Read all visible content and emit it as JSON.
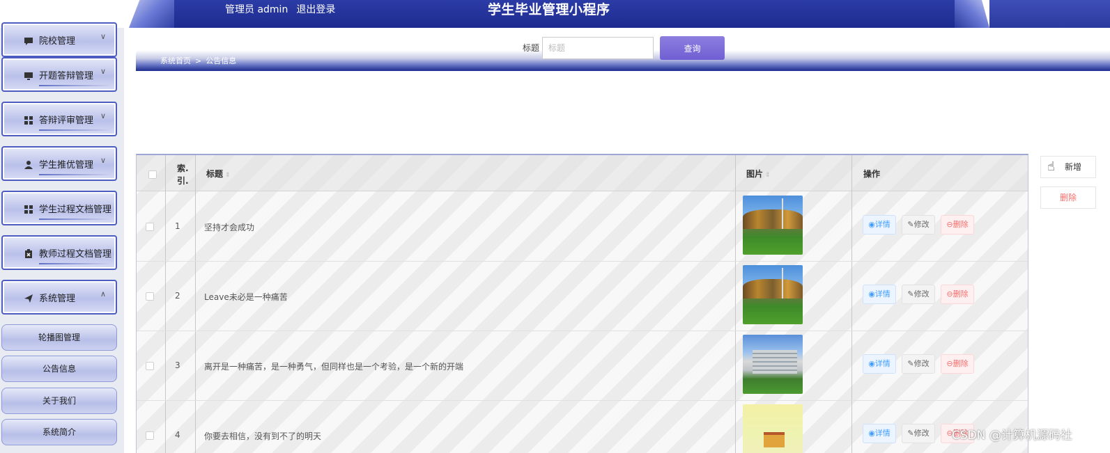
{
  "header": {
    "user_label": "管理员 admin",
    "logout_label": "退出登录",
    "app_title": "学生毕业管理小程序"
  },
  "sidebar": {
    "menus": [
      {
        "label": "院校管理",
        "icon": "comment-icon",
        "chevron": "∨"
      },
      {
        "label": "开题答辩管理",
        "icon": "monitor-icon",
        "chevron": "∨"
      },
      {
        "label": "答辩评审管理",
        "icon": "grid-icon",
        "chevron": "∨"
      },
      {
        "label": "学生推优管理",
        "icon": "user-icon",
        "chevron": "∨"
      },
      {
        "label": "学生过程文档管理",
        "icon": "grid-icon",
        "chevron": ""
      },
      {
        "label": "教师过程文档管理",
        "icon": "clipboard-icon",
        "chevron": ""
      },
      {
        "label": "系统管理",
        "icon": "send-icon",
        "chevron": "∧"
      }
    ],
    "submenu": [
      {
        "label": "轮播图管理"
      },
      {
        "label": "公告信息"
      },
      {
        "label": "关于我们"
      },
      {
        "label": "系统简介"
      }
    ]
  },
  "search": {
    "label": "标题",
    "placeholder": "标题",
    "button": "查询"
  },
  "breadcrumb": {
    "home": "系统首页",
    "separator": ">",
    "current": "公告信息"
  },
  "table": {
    "headers": {
      "index": "索.引.",
      "title": "标题",
      "image": "图片",
      "actions": "操作"
    },
    "rows": [
      {
        "index": "1",
        "title": "坚持才会成功",
        "thumb": "park"
      },
      {
        "index": "2",
        "title": "Leave未必是一种痛苦",
        "thumb": "park"
      },
      {
        "index": "3",
        "title": "离开是一种痛苦，是一种勇气，但同样也是一个考验，是一个新的开端",
        "thumb": "building"
      },
      {
        "index": "4",
        "title": "你要去相信，没有到不了的明天",
        "thumb": "cartoon"
      }
    ],
    "action_labels": {
      "detail": "详情",
      "edit": "修改",
      "delete": "删除"
    }
  },
  "actions": {
    "add": "新增",
    "delete": "删除"
  },
  "watermark": "CSDN @计算机源码社",
  "colors": {
    "header_blue": "#1d2b8f",
    "search_button": "#6f5fd3",
    "detail": "#409eff",
    "delete": "#f56c6c"
  }
}
